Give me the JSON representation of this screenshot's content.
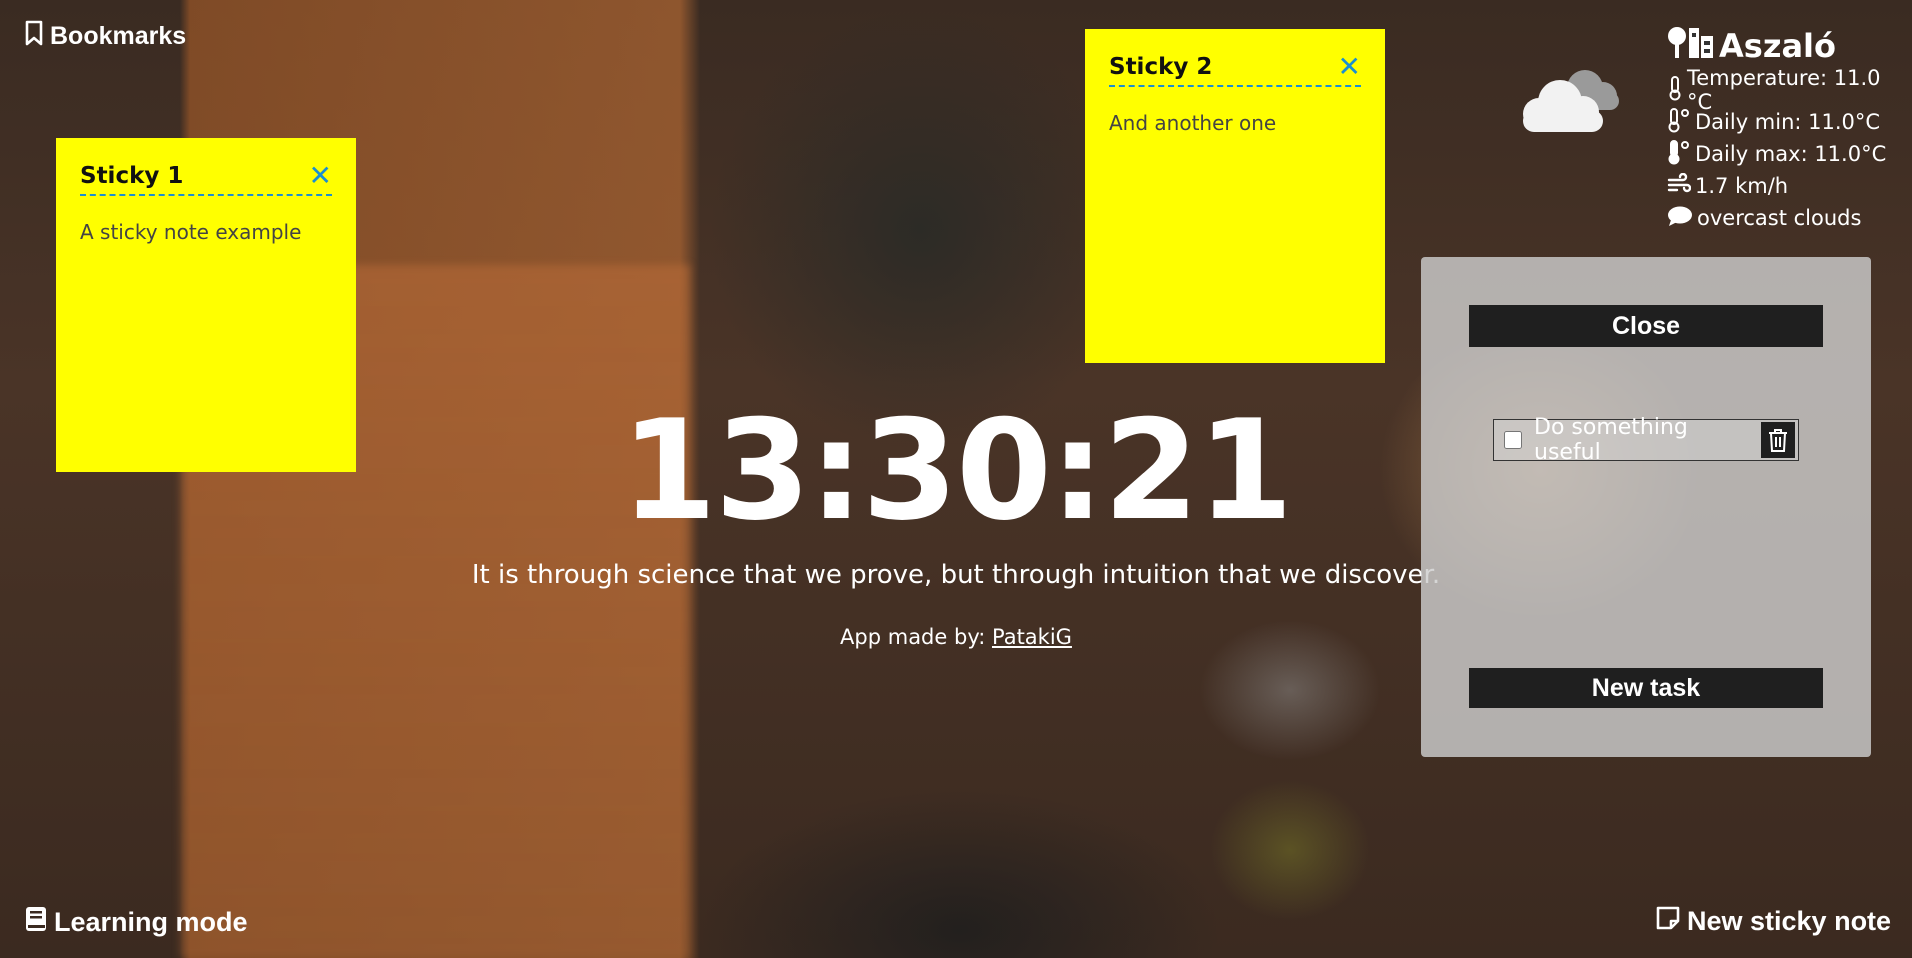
{
  "header": {
    "bookmarks_label": "Bookmarks"
  },
  "stickies": [
    {
      "title": "Sticky 1",
      "body": "A sticky note example"
    },
    {
      "title": "Sticky 2",
      "body": "And another one"
    }
  ],
  "clock": {
    "time": "13:30:21"
  },
  "quote": {
    "text": "It is through science that we prove, but through intuition that we discover."
  },
  "credit": {
    "prefix": "App made by:",
    "author": "PatakiG"
  },
  "weather": {
    "city": "Aszaló",
    "temperature": "Temperature: 11.0 °C",
    "daily_min": "Daily min: 11.0°C",
    "daily_max": "Daily max: 11.0°C",
    "wind": "1.7 km/h",
    "description": "overcast clouds",
    "icon": "overcast-cloud-icon"
  },
  "todo": {
    "close_label": "Close",
    "tasks": [
      {
        "label": "Do something useful",
        "done": false
      }
    ],
    "new_task_label": "New task"
  },
  "footer": {
    "learning_mode_label": "Learning mode",
    "new_sticky_label": "New sticky note"
  },
  "colors": {
    "sticky": "#ffff00",
    "sticky_accent": "#1a8fd0",
    "button": "#1f1f1f"
  }
}
